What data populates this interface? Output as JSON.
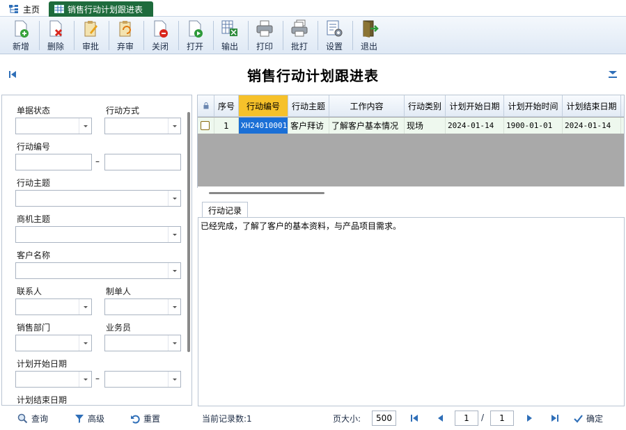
{
  "tabs": [
    {
      "label": "主页"
    },
    {
      "label": "销售行动计划跟进表"
    }
  ],
  "toolbar": [
    {
      "label": "新增",
      "icon": "new-doc-icon"
    },
    {
      "label": "删除",
      "icon": "delete-icon"
    },
    {
      "label": "审批",
      "icon": "approve-icon"
    },
    {
      "label": "弃审",
      "icon": "unapprove-icon"
    },
    {
      "label": "关闭",
      "icon": "close-doc-icon"
    },
    {
      "label": "打开",
      "icon": "open-doc-icon"
    },
    {
      "label": "输出",
      "icon": "export-icon"
    },
    {
      "label": "打印",
      "icon": "print-icon"
    },
    {
      "label": "批打",
      "icon": "batch-print-icon"
    },
    {
      "label": "设置",
      "icon": "settings-icon"
    },
    {
      "label": "退出",
      "icon": "exit-icon"
    }
  ],
  "page_title": "销售行动计划跟进表",
  "filters": {
    "status": "单据状态",
    "action_mode": "行动方式",
    "action_no": "行动编号",
    "action_subject": "行动主题",
    "opportunity": "商机主题",
    "customer": "客户名称",
    "contact": "联系人",
    "creator": "制单人",
    "dept": "销售部门",
    "salesman": "业务员",
    "plan_start": "计划开始日期",
    "plan_end": "计划结束日期",
    "range_sep": "–"
  },
  "grid": {
    "columns": [
      "序号",
      "行动编号",
      "行动主题",
      "工作内容",
      "行动类别",
      "计划开始日期",
      "计划开始时间",
      "计划结束日期"
    ],
    "rows": [
      [
        "1",
        "XH24010001",
        "客户拜访",
        "了解客户基本情况",
        "现场",
        "2024-01-14",
        "1900-01-01",
        "2024-01-14"
      ]
    ]
  },
  "detail": {
    "tab": "行动记录",
    "text": "已经完成，了解了客户的基本资料，与产品项目需求。"
  },
  "bottom": {
    "query": "查询",
    "advanced": "高级",
    "reset": "重置",
    "record_count": "当前记录数:1",
    "page_size_label": "页大小:",
    "page_size": "500",
    "page": "1",
    "page_sep": "/",
    "total_pages": "1",
    "confirm": "确定"
  }
}
